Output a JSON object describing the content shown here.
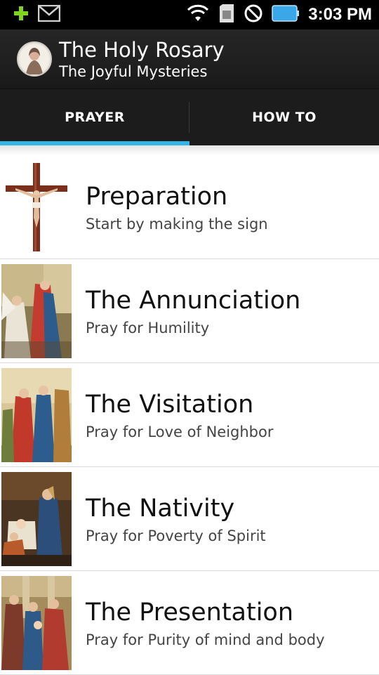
{
  "status_bar": {
    "time": "3:03 PM",
    "icons": [
      "plus-icon",
      "gmail-icon",
      "wifi-icon",
      "sim-icon",
      "no-signal-icon",
      "battery-icon"
    ]
  },
  "action_bar": {
    "title": "The Holy Rosary",
    "subtitle": "The Joyful Mysteries",
    "logo": "app-logo-icon"
  },
  "tabs": [
    {
      "label": "PRAYER",
      "selected": true
    },
    {
      "label": "HOW TO",
      "selected": false
    }
  ],
  "colors": {
    "accent": "#33b5e5",
    "actionbar": "#1f1f1f",
    "statusbar": "#000000"
  },
  "items": [
    {
      "title": "Preparation",
      "subtitle": "Start by making the sign",
      "image": "crucifix"
    },
    {
      "title": "The Annunciation",
      "subtitle": "Pray for Humility",
      "image": "annunciation-painting"
    },
    {
      "title": "The Visitation",
      "subtitle": "Pray for Love of Neighbor",
      "image": "visitation-painting"
    },
    {
      "title": "The Nativity",
      "subtitle": "Pray for Poverty of Spirit",
      "image": "nativity-painting"
    },
    {
      "title": "The Presentation",
      "subtitle": "Pray for Purity of mind and body",
      "image": "presentation-painting"
    }
  ]
}
